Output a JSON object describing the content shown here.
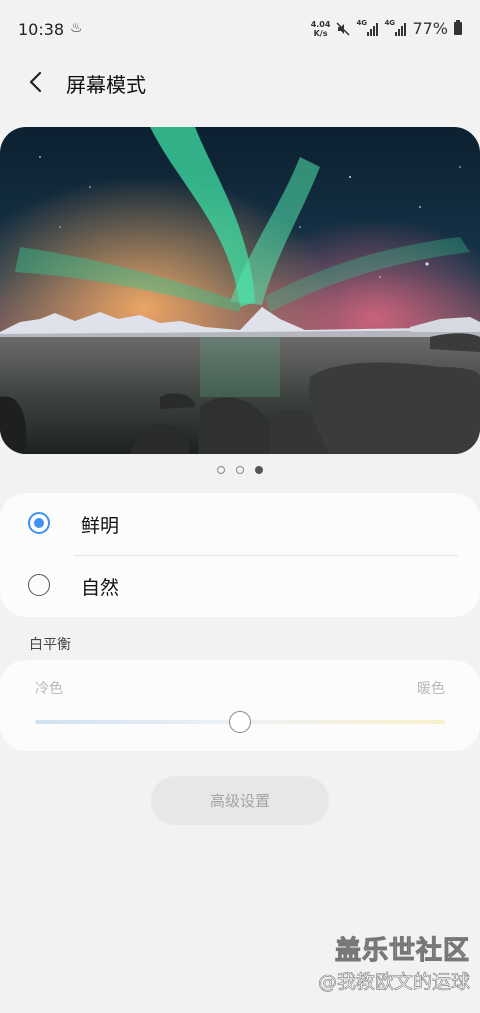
{
  "status_bar": {
    "time": "10:38",
    "net_speed_value": "4.04",
    "net_speed_unit": "K/s",
    "sim1_label": "4G",
    "sim2_label": "4G",
    "battery_percent": "77%"
  },
  "header": {
    "title": "屏幕模式"
  },
  "preview": {
    "page_count": 3,
    "active_page": 3
  },
  "modes": [
    {
      "label": "鲜明",
      "selected": true
    },
    {
      "label": "自然",
      "selected": false
    }
  ],
  "white_balance": {
    "section_title": "白平衡",
    "cool_label": "冷色",
    "warm_label": "暖色",
    "value": 0.5
  },
  "advanced_button": {
    "label": "高级设置"
  },
  "watermark": {
    "line1": "盖乐世社区",
    "line2": "@我教欧文的运球"
  },
  "colors": {
    "accent": "#3e91f2",
    "background": "#f2f2f2"
  }
}
